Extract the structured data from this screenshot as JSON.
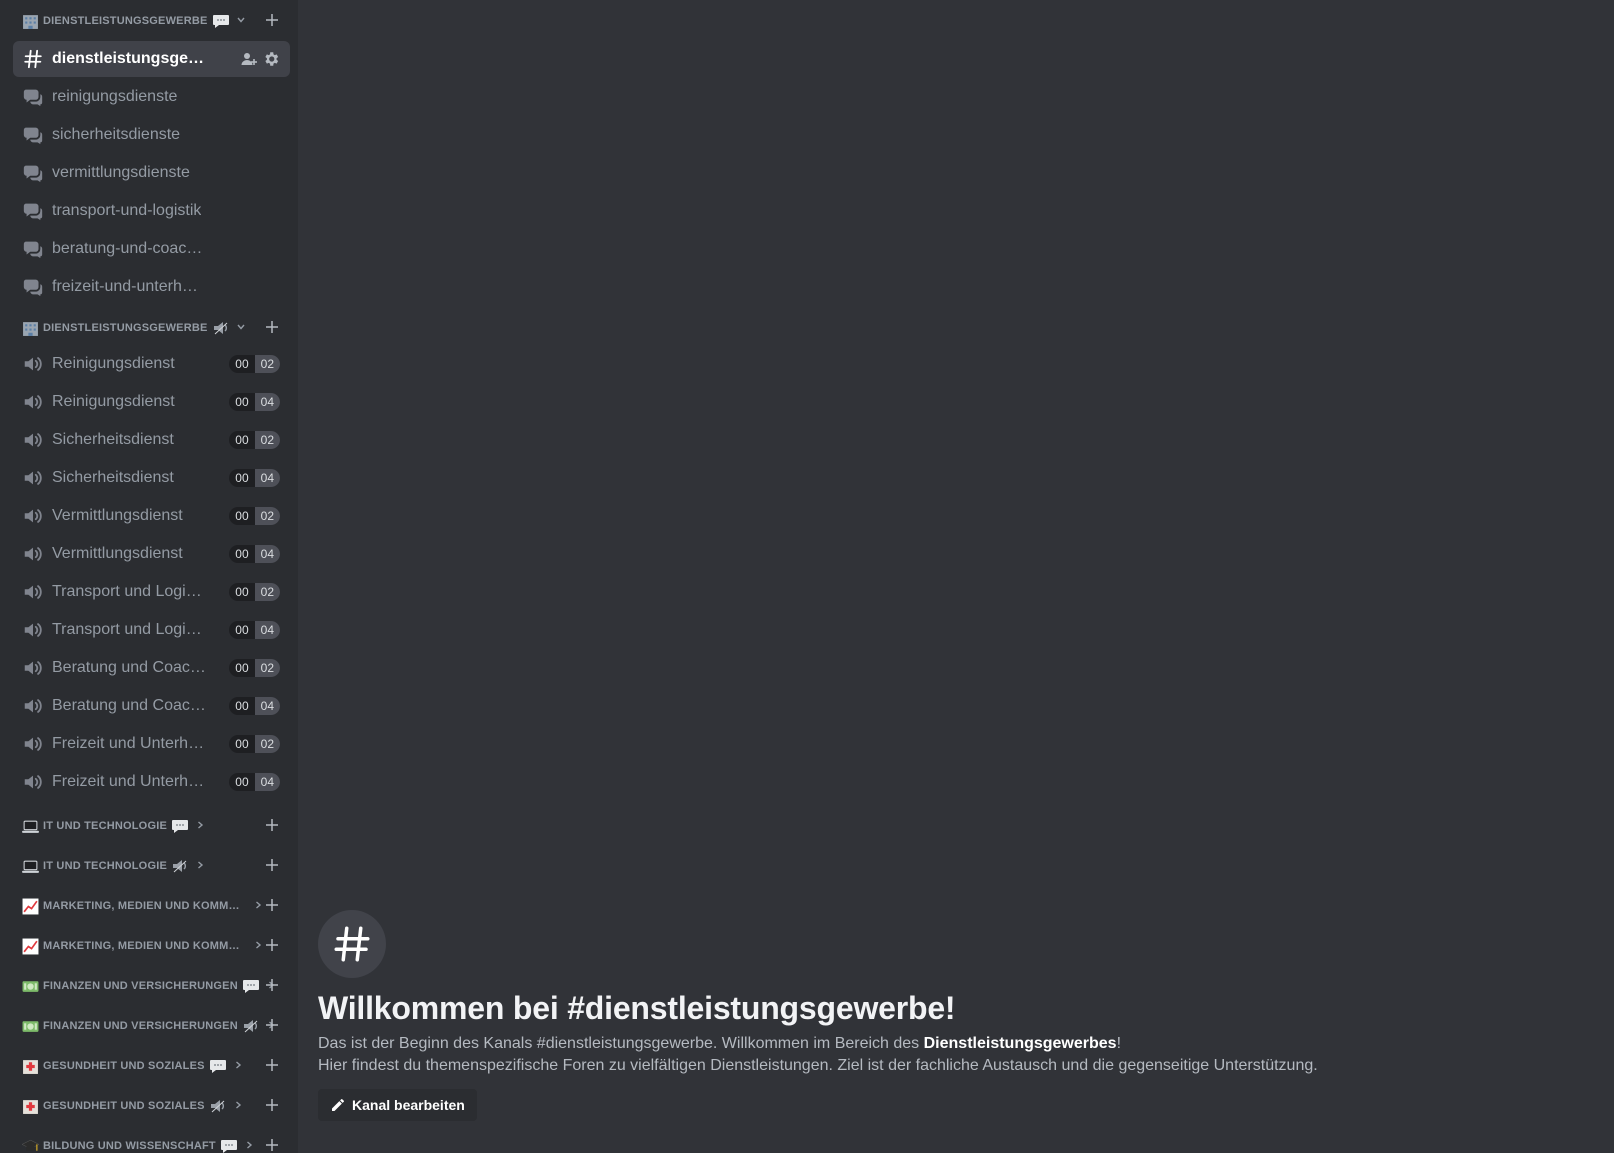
{
  "sidebar": {
    "cat1": {
      "label": "Dienstleistungsgewerbe",
      "emoji": "office-building",
      "suffix": "speech-bubble",
      "expanded": true
    },
    "text_channels": [
      {
        "name": "dienstleistungsgewerbe",
        "type": "text",
        "active": true
      },
      {
        "name": "reinigungsdienste",
        "type": "forum"
      },
      {
        "name": "sicherheitsdienste",
        "type": "forum"
      },
      {
        "name": "vermittlungsdienste",
        "type": "forum"
      },
      {
        "name": "transport-und-logistik",
        "type": "forum"
      },
      {
        "name": "beratung-und-coaching",
        "type": "forum"
      },
      {
        "name": "freizeit-und-unterhaltung",
        "type": "forum"
      }
    ],
    "cat2": {
      "label": "Dienstleistungsgewerbe",
      "emoji": "office-building",
      "suffix": "loudspeaker",
      "expanded": true
    },
    "voice_channels": [
      {
        "name": "Reinigungsdienst",
        "a": "00",
        "b": "02"
      },
      {
        "name": "Reinigungsdienst",
        "a": "00",
        "b": "04"
      },
      {
        "name": "Sicherheitsdienst",
        "a": "00",
        "b": "02"
      },
      {
        "name": "Sicherheitsdienst",
        "a": "00",
        "b": "04"
      },
      {
        "name": "Vermittlungsdienst",
        "a": "00",
        "b": "02"
      },
      {
        "name": "Vermittlungsdienst",
        "a": "00",
        "b": "04"
      },
      {
        "name": "Transport und Logis...",
        "a": "00",
        "b": "02"
      },
      {
        "name": "Transport und Logis...",
        "a": "00",
        "b": "04"
      },
      {
        "name": "Beratung und Coach...",
        "a": "00",
        "b": "02"
      },
      {
        "name": "Beratung und Coach...",
        "a": "00",
        "b": "04"
      },
      {
        "name": "Freizeit und Unterha...",
        "a": "00",
        "b": "02"
      },
      {
        "name": "Freizeit und Unterha...",
        "a": "00",
        "b": "04"
      }
    ],
    "collapsed_categories": [
      {
        "label": "IT und Technologie",
        "emoji": "laptop",
        "suffix": "speech-bubble"
      },
      {
        "label": "IT und Technologie",
        "emoji": "laptop",
        "suffix": "loudspeaker"
      },
      {
        "label": "Marketing, Medien und Kommuni...",
        "emoji": "chart-increasing",
        "suffix": ""
      },
      {
        "label": "Marketing, Medien und Kommuni...",
        "emoji": "chart-increasing",
        "suffix": ""
      },
      {
        "label": "Finanzen und Versicherungen",
        "emoji": "dollar-banknote",
        "suffix": "speech-bubble"
      },
      {
        "label": "Finanzen und Versicherungen",
        "emoji": "dollar-banknote",
        "suffix": "loudspeaker"
      },
      {
        "label": "Gesundheit und Soziales",
        "emoji": "hospital",
        "suffix": "speech-bubble"
      },
      {
        "label": "Gesundheit und Soziales",
        "emoji": "hospital",
        "suffix": "loudspeaker"
      },
      {
        "label": "Bildung und Wissenschaft",
        "emoji": "graduation-cap",
        "suffix": "speech-bubble"
      }
    ]
  },
  "welcome": {
    "title": "Willkommen bei #dienstleistungsgewerbe!",
    "line1_prefix": "Das ist der Beginn des Kanals #dienstleistungsgewerbe. Willkommen im Bereich des ",
    "line1_bold": "Dienstleistungsgewerbes",
    "line1_suffix": "!",
    "line2": "Hier findest du themenspezifische Foren zu vielfältigen Dienstleistungen. Ziel ist der fachliche Austausch und die gegenseitige Unterstützung.",
    "edit_button": "Kanal bearbeiten"
  },
  "colors": {
    "sidebar_bg": "#2b2d31",
    "main_bg": "#313338",
    "active_channel_bg": "#404249"
  }
}
